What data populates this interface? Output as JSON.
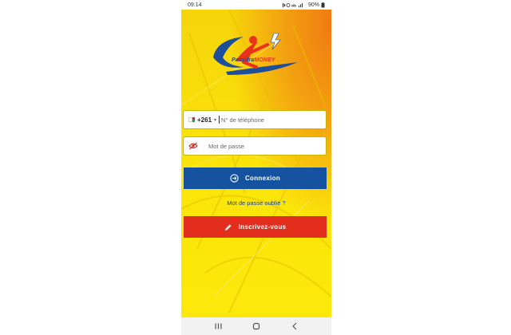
{
  "status_bar": {
    "time": "09:14",
    "battery": "90%"
  },
  "logo": {
    "brand_part1": "Paositra",
    "brand_part2": "MONEY"
  },
  "phone_field": {
    "country_code": "+261",
    "placeholder": "N° de téléphone",
    "value": ""
  },
  "password_field": {
    "placeholder": "Mot de passe",
    "value": ""
  },
  "buttons": {
    "login_label": "Connexion",
    "signup_label": "Inscrivez-vous"
  },
  "links": {
    "forgot_password": "Mot de passe oublié ?"
  },
  "icons": {
    "flag": "madagascar-flag-icon",
    "password_toggle": "eye-off-icon",
    "login": "login-arrow-icon",
    "signup": "pencil-icon",
    "nav_recent": "recent-apps-icon",
    "nav_home": "home-icon",
    "nav_back": "back-icon"
  },
  "colors": {
    "primary_blue": "#1553a0",
    "primary_red": "#e32d1d",
    "background_yellow": "#f6d50a"
  }
}
